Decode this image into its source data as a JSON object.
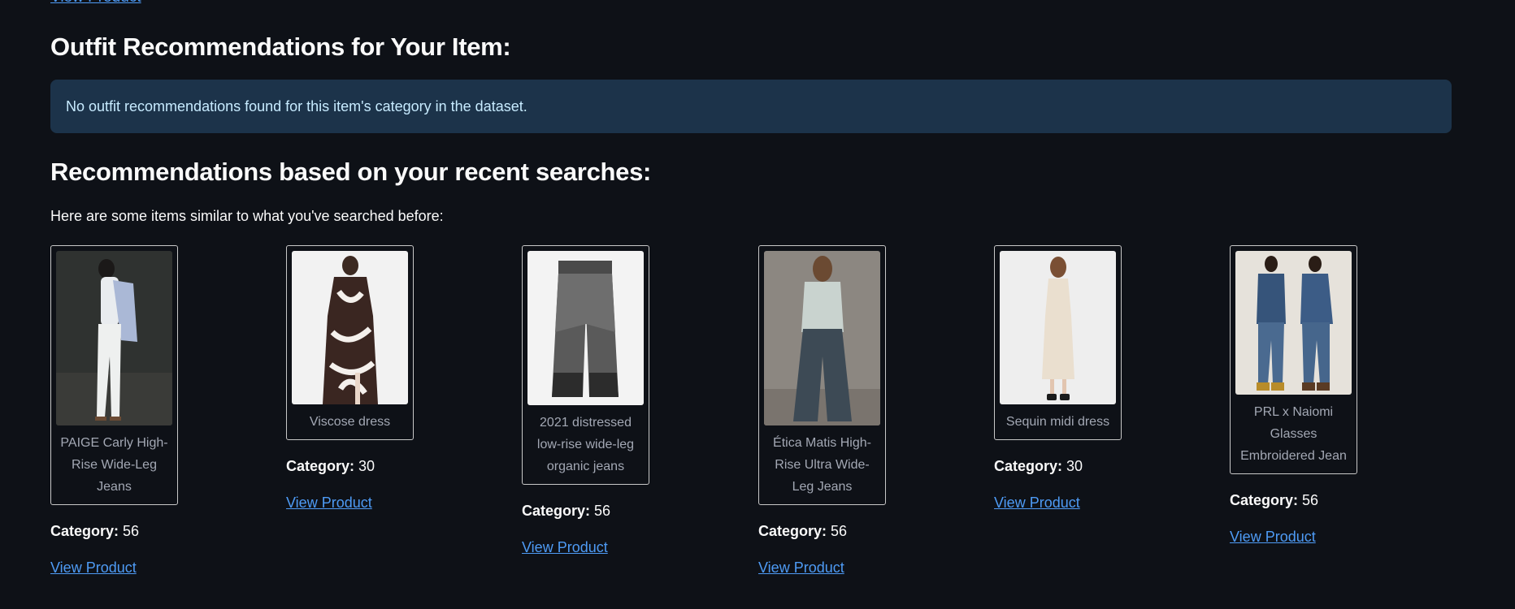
{
  "top_link": "View Product",
  "outfit": {
    "heading": "Outfit Recommendations for Your Item:",
    "info": "No outfit recommendations found for this item's category in the dataset."
  },
  "recent": {
    "heading": "Recommendations based on your recent searches:",
    "intro": "Here are some items similar to what you've searched before:"
  },
  "category_label": "Category:",
  "products": [
    {
      "name": "PAIGE Carly High-Rise Wide-Leg Jeans",
      "category": "56",
      "link": "View Product",
      "image": "woman-white-jeans-photo"
    },
    {
      "name": "Viscose dress",
      "category": "30",
      "link": "View Product",
      "image": "printed-dress-photo"
    },
    {
      "name": "2021 distressed low-rise wide-leg organic jeans",
      "category": "56",
      "link": "View Product",
      "image": "grey-jeans-photo"
    },
    {
      "name": "Ética Matis High-Rise Ultra Wide-Leg Jeans",
      "category": "56",
      "link": "View Product",
      "image": "woman-wide-jeans-photo"
    },
    {
      "name": "Sequin midi dress",
      "category": "30",
      "link": "View Product",
      "image": "cream-dress-photo"
    },
    {
      "name": "PRL x Naiomi Glasses Embroidered Jean",
      "category": "56",
      "link": "View Product",
      "image": "two-models-denim-photo"
    }
  ]
}
